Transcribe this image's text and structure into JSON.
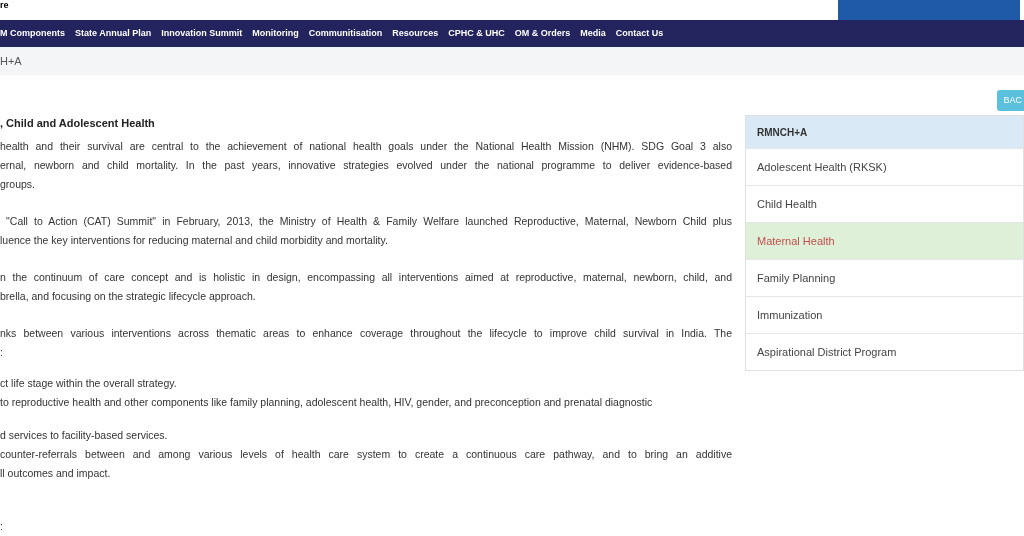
{
  "header": {
    "site_text": "re"
  },
  "nav": [
    "M Components",
    "State Annual Plan",
    "Innovation Summit",
    "Monitoring",
    "Communitisation",
    "Resources",
    "CPHC & UHC",
    "OM & Orders",
    "Media",
    "Contact Us"
  ],
  "breadcrumb": "H+A",
  "article": {
    "heading": ", Child and Adolescent Health",
    "paragraphs": [
      [
        "health and their survival are central to the achievement of national health goals under the National Health Mission (NHM). SDG Goal 3 also",
        "ernal, newborn and child mortality. In the past years, innovative strategies evolved under the national programme to deliver evidence-based",
        "groups."
      ],
      [
        " \"Call to Action (CAT) Summit\" in February, 2013, the Ministry of Health & Family Welfare launched Reproductive, Maternal, Newborn Child plus",
        "luence the key interventions for reducing maternal and child morbidity and mortality."
      ],
      [
        "n the continuum of care concept and is holistic in design, encompassing all interventions aimed at reproductive, maternal, newborn, child, and",
        "brella, and focusing on the strategic lifecycle approach."
      ],
      [
        "nks between various interventions across thematic areas to enhance coverage throughout the lifecycle to improve child survival in India. The",
        ":"
      ],
      [
        "ct life stage within the overall strategy.",
        "to reproductive health and other components like family planning, adolescent health, HIV, gender, and preconception and prenatal diagnostic"
      ],
      [
        "d services to facility-based services.",
        "counter-referrals between and among various levels of health care system to create a continuous care pathway, and to bring an additive",
        "ll outcomes and impact."
      ]
    ],
    "footer_fragment": ":"
  },
  "back_button": "BAC",
  "sidebar": {
    "title": "RMNCH+A",
    "items": [
      {
        "label": "Adolescent Health (RKSK)",
        "selected": false
      },
      {
        "label": "Child Health",
        "selected": false
      },
      {
        "label": "Maternal Health",
        "selected": true
      },
      {
        "label": "Family Planning",
        "selected": false
      },
      {
        "label": "Immunization",
        "selected": false
      },
      {
        "label": "Aspirational District Program",
        "selected": false
      }
    ]
  }
}
